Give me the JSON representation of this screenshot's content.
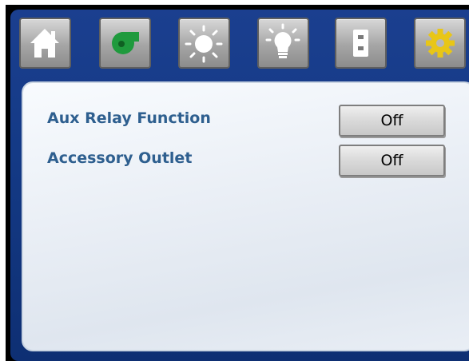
{
  "tabs": [
    {
      "icon": "home-icon"
    },
    {
      "icon": "blower-fan-icon",
      "color": "#1f9a3d"
    },
    {
      "icon": "sun-icon"
    },
    {
      "icon": "light-bulb-icon"
    },
    {
      "icon": "outlet-icon"
    },
    {
      "icon": "settings-gear-icon",
      "color": "#e8c617"
    }
  ],
  "settings": {
    "rows": [
      {
        "label": "Aux Relay Function",
        "value": "Off"
      },
      {
        "label": "Accessory Outlet",
        "value": "Off"
      }
    ]
  },
  "colors": {
    "frame_blue": "#143a86",
    "label_blue": "#2e5f8f",
    "panel_bg": "#e9eef5"
  }
}
